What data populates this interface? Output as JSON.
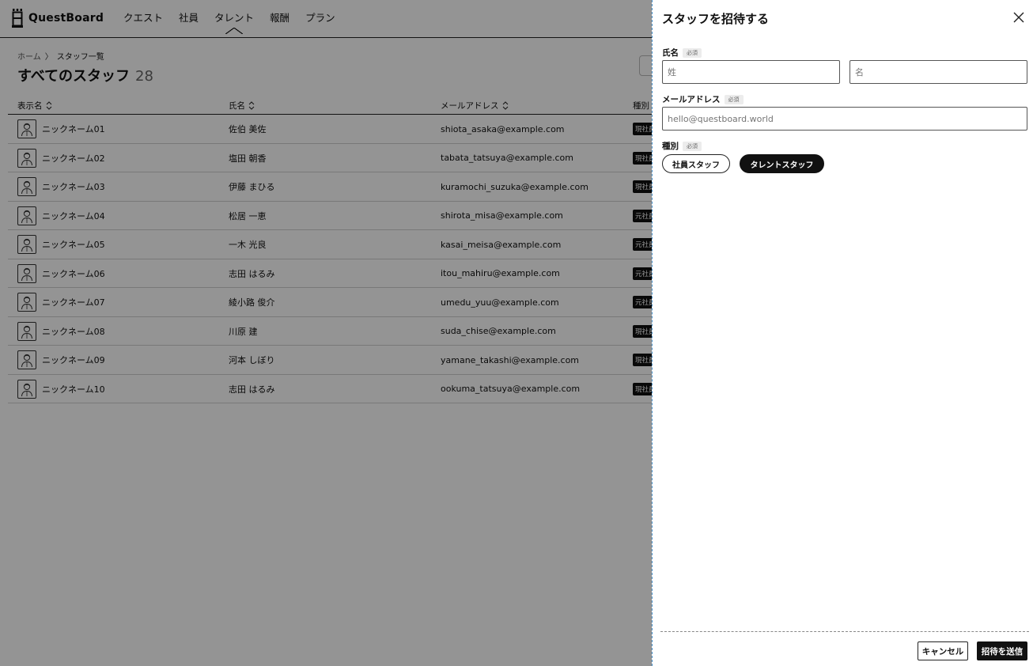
{
  "app": {
    "logo_text": "QuestBoard",
    "nav": [
      "クエスト",
      "社員",
      "タレント",
      "報酬",
      "プラン"
    ],
    "active_nav": "タレント",
    "breadcrumb": {
      "home": "ホーム",
      "current": "スタッフ一覧"
    },
    "page_title": "すべてのスタッフ",
    "count": "28",
    "columns": [
      "表示名",
      "氏名",
      "メールアドレス",
      "種別"
    ],
    "rows": [
      {
        "nickname": "ニックネーム01",
        "name": "佐伯 美佐",
        "email": "shiota_asaka@example.com",
        "type": "現社員"
      },
      {
        "nickname": "ニックネーム02",
        "name": "塩田 朝香",
        "email": "tabata_tatsuya@example.com",
        "type": "現社員"
      },
      {
        "nickname": "ニックネーム03",
        "name": "伊藤 まひる",
        "email": "kuramochi_suzuka@example.com",
        "type": "現社員"
      },
      {
        "nickname": "ニックネーム04",
        "name": "松居 一恵",
        "email": "shirota_misa@example.com",
        "type": "元社員"
      },
      {
        "nickname": "ニックネーム05",
        "name": "一木 光良",
        "email": "kasai_meisa@example.com",
        "type": "元社員"
      },
      {
        "nickname": "ニックネーム06",
        "name": "志田 はるみ",
        "email": "itou_mahiru@example.com",
        "type": "元社員"
      },
      {
        "nickname": "ニックネーム07",
        "name": "綾小路 俊介",
        "email": "umedu_yuu@example.com",
        "type": "元社員"
      },
      {
        "nickname": "ニックネーム08",
        "name": "川原 建",
        "email": "suda_chise@example.com",
        "type": "現社員"
      },
      {
        "nickname": "ニックネーム09",
        "name": "河本 しぼり",
        "email": "yamane_takashi@example.com",
        "type": "現社員"
      },
      {
        "nickname": "ニックネーム10",
        "name": "志田 はるみ",
        "email": "ookuma_tatsuya@example.com",
        "type": "現社員"
      }
    ]
  },
  "drawer": {
    "title": "スタッフを招待する",
    "required_label": "必須",
    "name_label": "氏名",
    "last_name_placeholder": "姓",
    "first_name_placeholder": "名",
    "email_label": "メールアドレス",
    "email_placeholder": "hello@questboard.world",
    "type_label": "種別",
    "type_options": [
      "社員スタッフ",
      "タレントスタッフ"
    ],
    "type_selected": "タレントスタッフ",
    "cancel_label": "キャンセル",
    "submit_label": "招待を送信"
  }
}
